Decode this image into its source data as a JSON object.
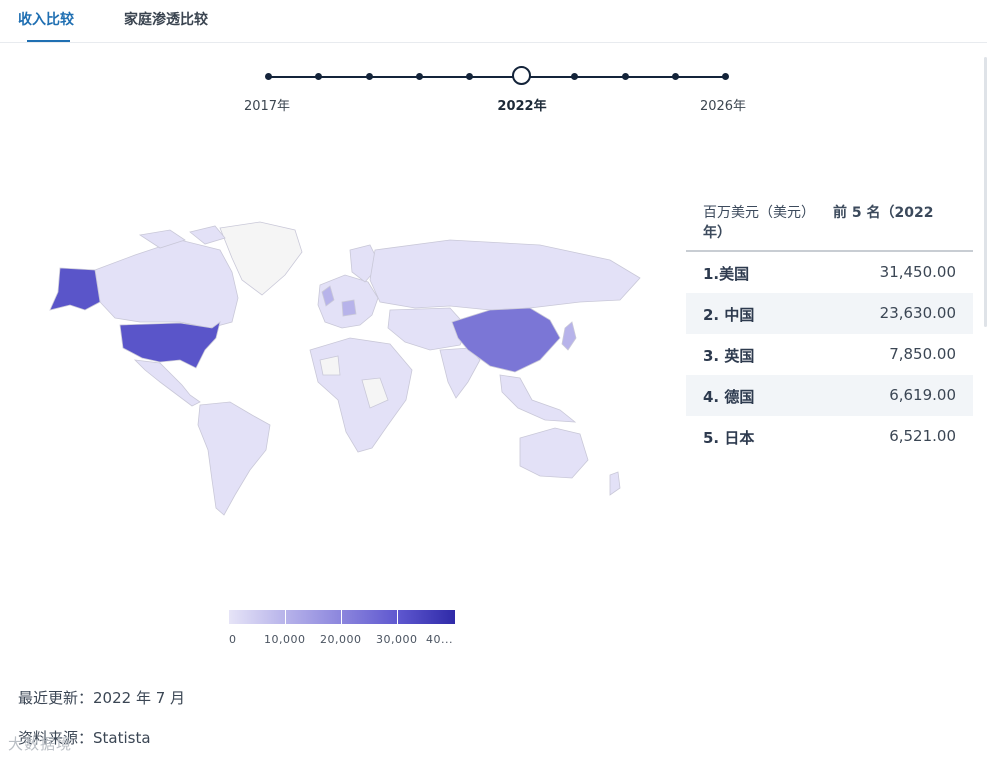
{
  "tabs": {
    "revenue": "收入比较",
    "household": "家庭渗透比较"
  },
  "timeline": {
    "label_start": "2017年",
    "label_current": "2022年",
    "label_end": "2026年"
  },
  "table": {
    "header_unit": "百万美元（美元）",
    "header_title": "前 5 名（2022",
    "header_title_cont": "年）",
    "rows": [
      {
        "name": "1.美国",
        "value": "31,450.00"
      },
      {
        "name": "2. 中国",
        "value": "23,630.00"
      },
      {
        "name": "3. 英国",
        "value": "7,850.00"
      },
      {
        "name": "4. 德国",
        "value": "6,619.00"
      },
      {
        "name": "5. 日本",
        "value": "6,521.00"
      }
    ]
  },
  "legend": {
    "ticks": [
      "0",
      "10,000",
      "20,000",
      "30,000",
      "40..."
    ]
  },
  "footer": {
    "updated": "最近更新：2022 年 7 月",
    "source": "资料来源：Statista"
  },
  "watermark": "大数据境",
  "colors": {
    "accent": "#1f6fb2",
    "usa": "#5a55c9",
    "china": "#7b76d6",
    "light": "#e3e1f7",
    "nodata": "#f5f5f5"
  }
}
